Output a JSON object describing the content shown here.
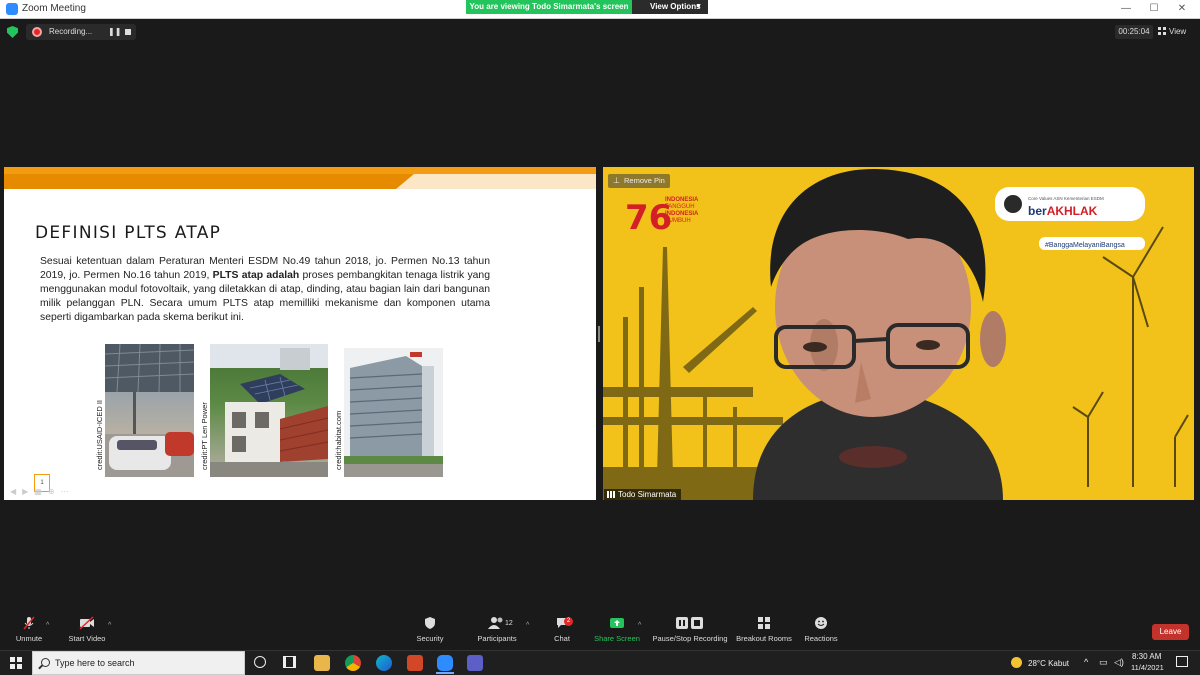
{
  "window": {
    "title": "Zoom Meeting",
    "share_banner": "You are viewing Todo Simarmata's screen",
    "view_options": "View Options"
  },
  "recording": {
    "label": "Recording...",
    "pause": "❚❚"
  },
  "timer": "00:25:04",
  "view_button": "View",
  "slide": {
    "title": "DEFINISI PLTS ATAP",
    "body_part1": "Sesuai ketentuan dalam Peraturan Menteri ESDM No.49 tahun 2018, jo. Permen No.13 tahun 2019, jo. Permen No.16 tahun 2019, ",
    "body_bold": "PLTS atap adalah",
    "body_part2": " proses pembangkitan tenaga listrik yang menggunakan modul fotovoltaik, yang diletakkan di atap, dinding, atau bagian lain dari bangunan milik pelanggan PLN. Secara umum PLTS atap memilliki mekanisme dan komponen utama seperti digambarkan pada skema berikut ini.",
    "credits": [
      "credit:USAID-ICED II",
      "credit:PT Len Power",
      "credit:habitat.com"
    ],
    "page": "1"
  },
  "video": {
    "remove_pin": "Remove Pin",
    "participant_name": "Todo Simarmata",
    "banner_number": "76",
    "banner_line1": "INDONESIA",
    "banner_line2": "TANGGUH",
    "banner_line3": "INDONESIA",
    "banner_line4": "TUMBUH",
    "logo_tag": "Core Values ASN Kementerian ESDM",
    "logo_text_plain": "ber",
    "logo_text_bold": "AKHLAK",
    "hashtag": "#BanggaMelayaniBangsa"
  },
  "toolbar": {
    "unmute": "Unmute",
    "start_video": "Start Video",
    "security": "Security",
    "participants": "Participants",
    "participants_count": "12",
    "chat": "Chat",
    "chat_badge": "2",
    "share_screen": "Share Screen",
    "pause_stop_recording": "Pause/Stop Recording",
    "breakout_rooms": "Breakout Rooms",
    "reactions": "Reactions",
    "leave": "Leave"
  },
  "taskbar": {
    "search_placeholder": "Type here to search",
    "weather": "28°C  Kabut",
    "time": "8:30 AM",
    "date": "11/4/2021"
  },
  "colors": {
    "share_green": "#23c45b",
    "slide_orange": "#f39c12",
    "video_yellow": "#f2c21a",
    "leave_red": "#c4332b",
    "recording_red": "#e02828"
  }
}
